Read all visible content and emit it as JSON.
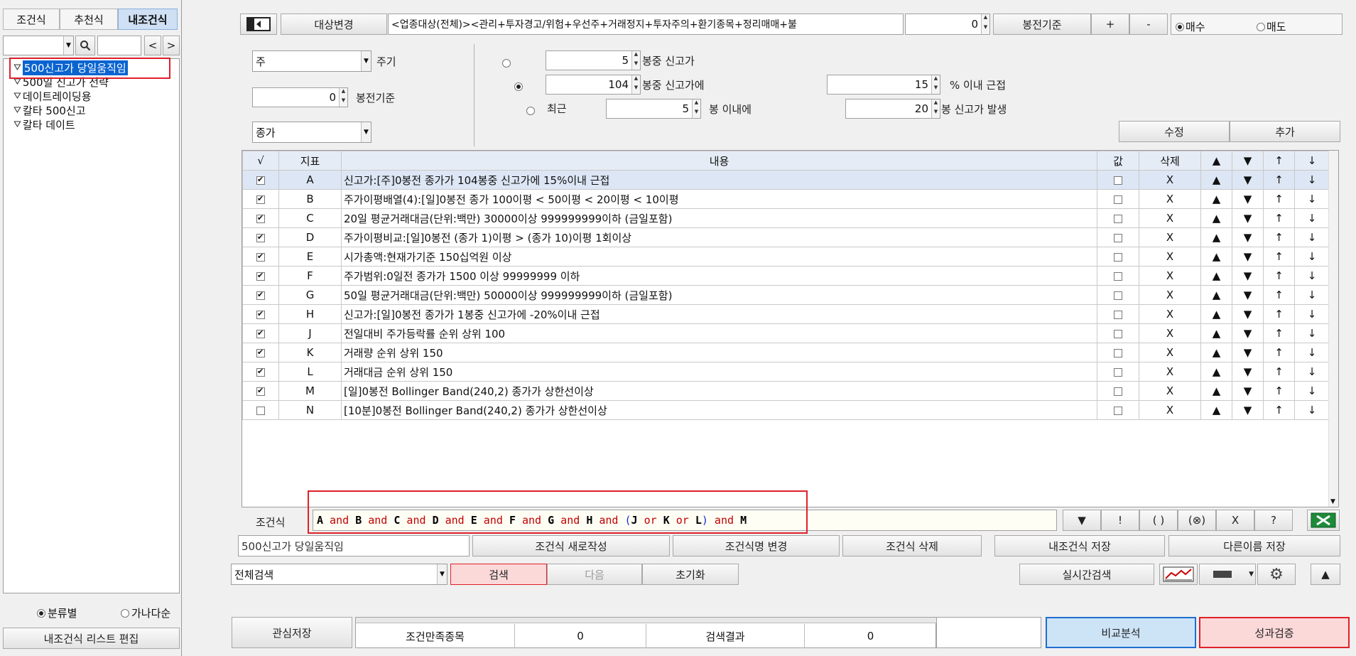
{
  "left_panel": {
    "tabs": [
      "조건식",
      "추천식",
      "내조건식"
    ],
    "active_tab": 2,
    "tree_items": [
      "500신고가 당일움직임",
      "500일 신고가 전략",
      "데이트레이딩용",
      "칼타 500신고",
      "칼타 데이트"
    ],
    "selected_item": 0,
    "sort_options": [
      "분류별",
      "가나다순"
    ],
    "sort_selected": 0,
    "edit_list_button": "내조건식 리스트 편집"
  },
  "toolbar": {
    "target_change_button": "대상변경",
    "target_text": "<업종대상(전체)><관리+투자경고/위험+우선주+거래정지+투자주의+환기종목+정리매매+불",
    "bar_offset_value": "0",
    "bar_basis_button": "봉전기준",
    "plus_button": "+",
    "minus_button": "-",
    "buy_label": "매수",
    "sell_label": "매도",
    "buy_selected": true
  },
  "params": {
    "period_value": "주",
    "period_label": "주기",
    "bar_basis_value": "0",
    "bar_basis_label": "봉전기준",
    "price_value": "종가",
    "row1_bars": "5",
    "row1_label": "봉중 신고가",
    "row2_bars": "104",
    "row2_label": "봉중 신고가에",
    "row2_pct": "15",
    "row2_pct_label": "% 이내 근접",
    "row3_prefix": "최근",
    "row3_bars": "5",
    "row3_label": "봉 이내에",
    "row3_bars2": "20",
    "row3_label2": "봉 신고가 발생",
    "radio_selected": 1,
    "edit_button": "수정",
    "add_button": "추가"
  },
  "table": {
    "headers": [
      "√",
      "지표",
      "내용",
      "값",
      "삭제",
      "▲",
      "▼",
      "↑",
      "↓"
    ],
    "rows": [
      {
        "checked": true,
        "id": "A",
        "content": "신고가:[주]0봉전 종가가 104봉중 신고가에 15%이내 근접"
      },
      {
        "checked": true,
        "id": "B",
        "content": "주가이평배열(4):[일]0봉전 종가 100이평 < 50이평 < 20이평 < 10이평"
      },
      {
        "checked": true,
        "id": "C",
        "content": "20일 평균거래대금(단위:백만) 30000이상 999999999이하 (금일포함)"
      },
      {
        "checked": true,
        "id": "D",
        "content": "주가이평비교:[일]0봉전 (종가 1)이평 > (종가 10)이평 1회이상"
      },
      {
        "checked": true,
        "id": "E",
        "content": "시가총액:현재가기준 150십억원 이상"
      },
      {
        "checked": true,
        "id": "F",
        "content": "주가범위:0일전 종가가 1500 이상 99999999 이하"
      },
      {
        "checked": true,
        "id": "G",
        "content": "50일 평균거래대금(단위:백만) 50000이상 999999999이하 (금일포함)"
      },
      {
        "checked": true,
        "id": "H",
        "content": "신고가:[일]0봉전 종가가 1봉중 신고가에 -20%이내 근접"
      },
      {
        "checked": true,
        "id": "J",
        "content": "전일대비 주가등락률 순위 상위 100"
      },
      {
        "checked": true,
        "id": "K",
        "content": "거래량 순위 상위 150"
      },
      {
        "checked": true,
        "id": "L",
        "content": "거래대금 순위 상위 150"
      },
      {
        "checked": true,
        "id": "M",
        "content": "[일]0봉전 Bollinger Band(240,2) 종가가 상한선이상"
      },
      {
        "checked": false,
        "id": "N",
        "content": "[10분]0봉전 Bollinger Band(240,2) 종가가 상한선이상"
      }
    ],
    "delete_mark": "X",
    "up_mark": "▲",
    "down_mark": "▼",
    "top_mark": "↑",
    "bottom_mark": "↓"
  },
  "formula": {
    "label": "조건식",
    "tokens": [
      {
        "t": "A",
        "k": "id"
      },
      {
        "t": " and ",
        "k": "op"
      },
      {
        "t": "B",
        "k": "id"
      },
      {
        "t": " and ",
        "k": "op"
      },
      {
        "t": "C",
        "k": "id"
      },
      {
        "t": " and ",
        "k": "op"
      },
      {
        "t": "D",
        "k": "id"
      },
      {
        "t": " and ",
        "k": "op"
      },
      {
        "t": "E",
        "k": "id"
      },
      {
        "t": " and ",
        "k": "op"
      },
      {
        "t": "F",
        "k": "id"
      },
      {
        "t": " and ",
        "k": "op"
      },
      {
        "t": "G",
        "k": "id"
      },
      {
        "t": " and ",
        "k": "op"
      },
      {
        "t": "H",
        "k": "id"
      },
      {
        "t": " and ",
        "k": "op"
      },
      {
        "t": "(",
        "k": "paren"
      },
      {
        "t": "J",
        "k": "id"
      },
      {
        "t": " or ",
        "k": "op"
      },
      {
        "t": "K",
        "k": "id"
      },
      {
        "t": " or ",
        "k": "op"
      },
      {
        "t": "L",
        "k": "id"
      },
      {
        "t": ")",
        "k": "paren"
      },
      {
        "t": " and ",
        "k": "op"
      },
      {
        "t": "M",
        "k": "id"
      }
    ],
    "buttons": [
      "▼",
      "!",
      "( )",
      "(⊗)",
      "X",
      "?"
    ]
  },
  "condition_actions": {
    "name_value": "500신고가 당일움직임",
    "new_button": "조건식 새로작성",
    "rename_button": "조건식명 변경",
    "delete_button": "조건식 삭제",
    "save_button": "내조건식 저장",
    "save_as_button": "다른이름 저장"
  },
  "search_bar": {
    "scope_value": "전체검색",
    "search_button": "검색",
    "next_button": "다음",
    "reset_button": "초기화",
    "realtime_button": "실시간검색"
  },
  "footer": {
    "save_interest_button": "관심저장",
    "matched_label": "조건만족종목",
    "matched_value": "0",
    "result_label": "검색결과",
    "result_value": "0",
    "compare_button": "비교분석",
    "performance_button": "성과검증"
  },
  "colors": {
    "selected_tab": "#cfe0f5",
    "highlight_red": "#e0202a",
    "operator_red": "#c00000",
    "paren_blue": "#1a2fd0",
    "search_pink": "#fcd9d9",
    "compare_blue": "#cde4f7",
    "perf_pink": "#fcd9d9",
    "tree_selected": "#0a64d0"
  }
}
